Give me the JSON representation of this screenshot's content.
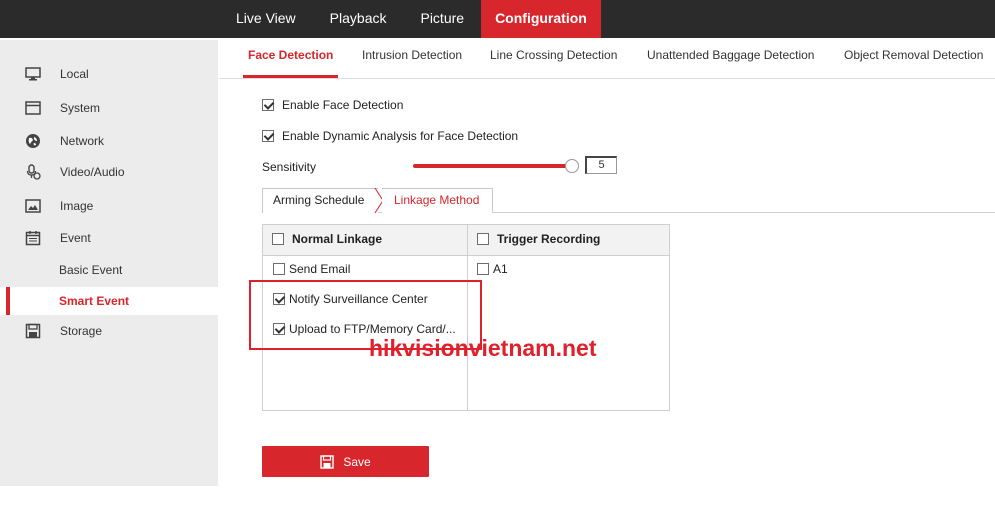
{
  "topnav": {
    "items": [
      {
        "label": "Live View"
      },
      {
        "label": "Playback"
      },
      {
        "label": "Picture"
      },
      {
        "label": "Configuration",
        "active": true
      }
    ]
  },
  "sidebar": {
    "items": [
      {
        "label": "Local",
        "icon": "monitor-icon"
      },
      {
        "label": "System",
        "icon": "window-icon"
      },
      {
        "label": "Network",
        "icon": "globe-icon"
      },
      {
        "label": "Video/Audio",
        "icon": "microphone-icon"
      },
      {
        "label": "Image",
        "icon": "image-icon"
      },
      {
        "label": "Event",
        "icon": "calendar-icon"
      },
      {
        "label": "Basic Event"
      },
      {
        "label": "Smart Event",
        "active": true
      },
      {
        "label": "Storage",
        "icon": "disk-icon"
      }
    ]
  },
  "tabs": [
    {
      "label": "Face Detection",
      "active": true
    },
    {
      "label": "Intrusion Detection"
    },
    {
      "label": "Line Crossing Detection"
    },
    {
      "label": "Unattended Baggage Detection"
    },
    {
      "label": "Object Removal Detection"
    }
  ],
  "settings": {
    "enable_face_detection": {
      "label": "Enable Face Detection",
      "checked": true
    },
    "enable_dynamic_analysis": {
      "label": "Enable Dynamic Analysis for Face Detection",
      "checked": true
    },
    "sensitivity": {
      "label": "Sensitivity",
      "value": "5"
    }
  },
  "subtabs": [
    {
      "label": "Arming Schedule"
    },
    {
      "label": "Linkage Method",
      "active": true
    }
  ],
  "linkage": {
    "normal_header": "Normal Linkage",
    "trigger_header": "Trigger Recording",
    "normal_items": [
      {
        "label": "Send Email",
        "checked": false
      },
      {
        "label": "Notify Surveillance Center",
        "checked": true
      },
      {
        "label": "Upload to FTP/Memory Card/...",
        "checked": true
      }
    ],
    "trigger_items": [
      {
        "label": "A1",
        "checked": false
      }
    ]
  },
  "watermark": "hikvisionvietnam.net",
  "save_label": "Save",
  "colors": {
    "accent": "#d7262c",
    "topbar": "#2b2b2b",
    "sidebar": "#ececec"
  }
}
